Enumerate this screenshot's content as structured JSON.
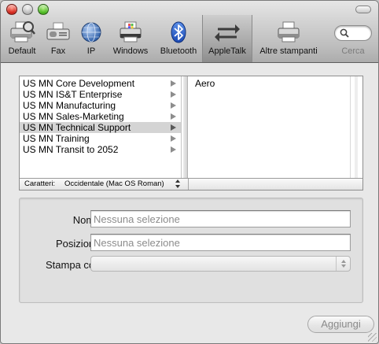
{
  "toolbar": {
    "items": [
      {
        "label": "Default",
        "icon": "default-printer-icon"
      },
      {
        "label": "Fax",
        "icon": "fax-icon"
      },
      {
        "label": "IP",
        "icon": "ip-globe-icon"
      },
      {
        "label": "Windows",
        "icon": "windows-printer-icon"
      },
      {
        "label": "Bluetooth",
        "icon": "bluetooth-icon"
      },
      {
        "label": "AppleTalk",
        "icon": "appletalk-arrows-icon",
        "selected": true
      },
      {
        "label": "Altre stampanti",
        "icon": "more-printers-icon"
      }
    ],
    "search_label": "Cerca",
    "search_value": ""
  },
  "browser": {
    "column1": [
      "US MN Core Development",
      "US MN IS&T Enterprise",
      "US MN Manufacturing",
      "US MN Sales-Marketing",
      "US MN Technical Support",
      "US MN Training",
      "US MN Transit to 2052"
    ],
    "column1_selected_index": 4,
    "column2": [
      "Aero"
    ],
    "charset_label": "Caratteri:",
    "charset_value": "Occidentale (Mac OS Roman)"
  },
  "form": {
    "name_label": "Nome:",
    "name_placeholder": "Nessuna selezione",
    "location_label": "Posizione:",
    "location_placeholder": "Nessuna selezione",
    "print_using_label": "Stampa con:",
    "print_using_value": ""
  },
  "add_button_label": "Aggiungi",
  "colors": {
    "selection": "#d4d4d4",
    "window_bg": "#e8e8e8",
    "close": "#d6261b",
    "zoom": "#4dbb21"
  }
}
